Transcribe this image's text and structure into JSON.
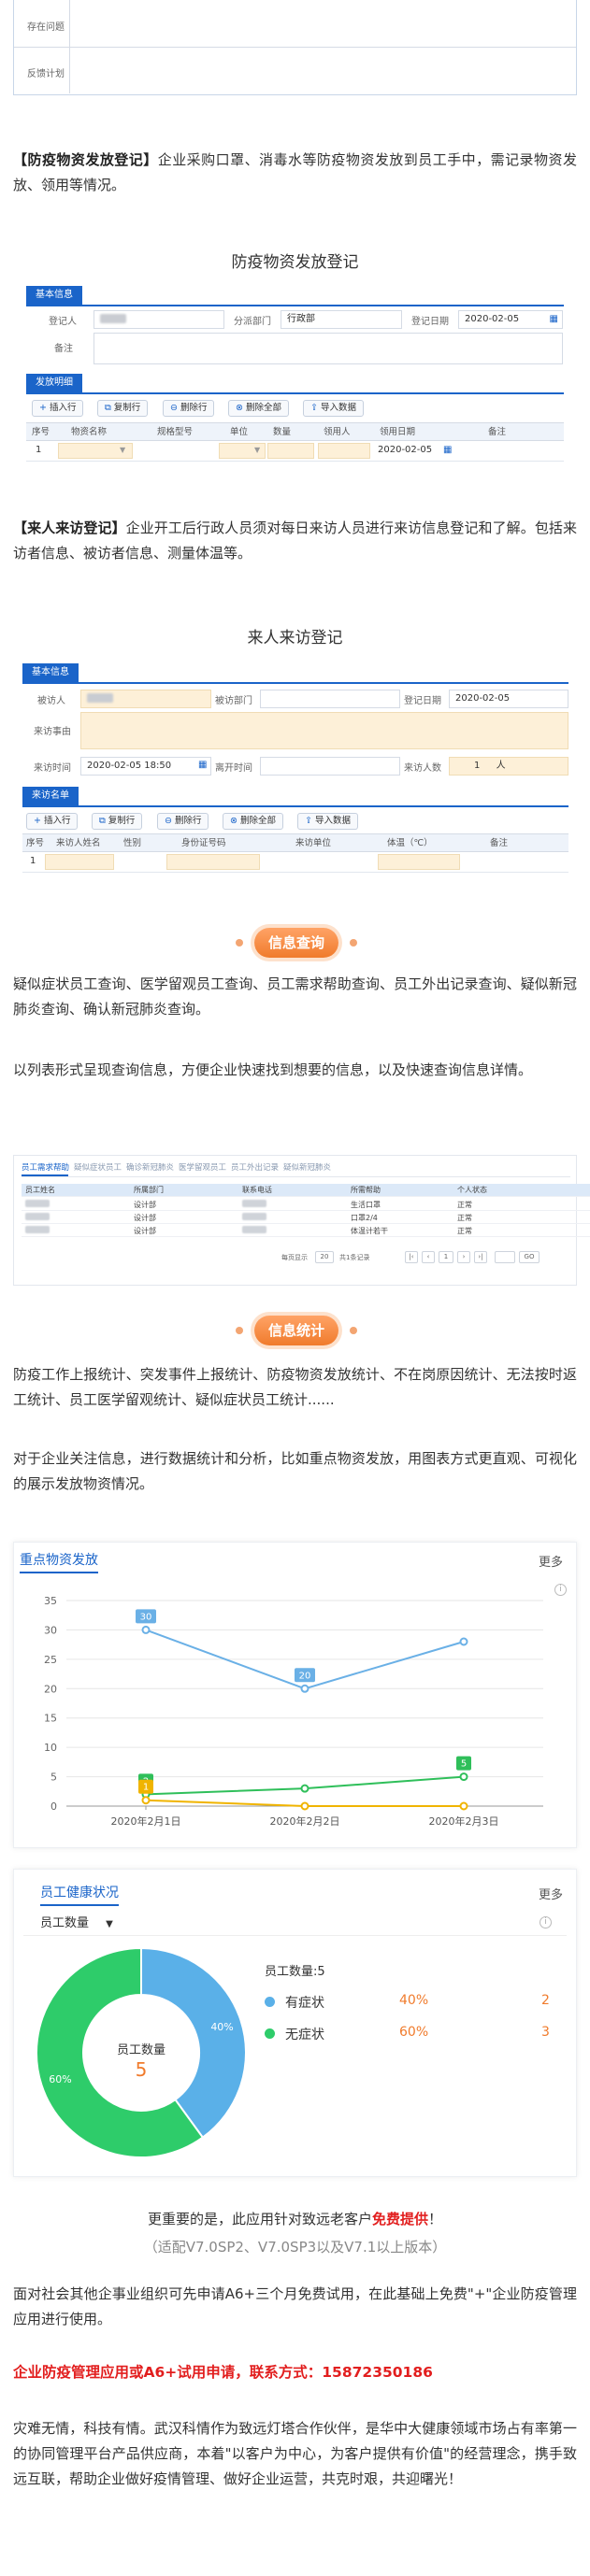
{
  "top_form": {
    "rows": [
      {
        "label": "存在问题"
      },
      {
        "label": "反馈计划"
      }
    ]
  },
  "intro_supplies": {
    "heading": "【防疫物资发放登记】",
    "text": "企业采购口罩、消毒水等防疫物资发放到员工手中，需记录物资发放、领用等情况。"
  },
  "supply_form": {
    "title": "防疫物资发放登记",
    "basic_tag": "基本信息",
    "registrant_label": "登记人",
    "dept_label": "分派部门",
    "dept_value": "行政部",
    "date_label": "登记日期",
    "date_value": "2020-02-05",
    "remark_label": "备注",
    "detail_tag": "发放明细",
    "buttons": {
      "insert": "插入行",
      "copy": "复制行",
      "delete": "删除行",
      "delete_all": "删除全部",
      "import": "导入数据"
    },
    "columns": [
      "序号",
      "物资名称",
      "规格型号",
      "单位",
      "数量",
      "领用人",
      "领用日期",
      "备注"
    ],
    "row": {
      "index": "1",
      "date": "2020-02-05"
    }
  },
  "intro_visitor": {
    "heading": "【来人来访登记】",
    "text": "企业开工后行政人员须对每日来访人员进行来访信息登记和了解。包括来访者信息、被访者信息、测量体温等。"
  },
  "visitor_form": {
    "title": "来人来访登记",
    "basic_tag": "基本信息",
    "visitee_label": "被访人",
    "visitee_dept_label": "被访部门",
    "reg_date_label": "登记日期",
    "reg_date_value": "2020-02-05",
    "reason_label": "来访事由",
    "visit_time_label": "来访时间",
    "visit_time_value": "2020-02-05 18:50",
    "leave_time_label": "离开时间",
    "count_label": "来访人数",
    "count_value": "1",
    "count_unit": "人",
    "detail_tag": "来访名单",
    "buttons": {
      "insert": "插入行",
      "copy": "复制行",
      "delete": "删除行",
      "delete_all": "删除全部",
      "import": "导入数据"
    },
    "columns": [
      "序号",
      "来访人姓名",
      "性别",
      "身份证号码",
      "来访单位",
      "体温（℃）",
      "备注"
    ],
    "row": {
      "index": "1"
    }
  },
  "query_section": {
    "badge": "信息查询",
    "text1": "疑似症状员工查询、医学留观员工查询、员工需求帮助查询、员工外出记录查询、疑似新冠肺炎查询、确认新冠肺炎查询。",
    "text2": "以列表形式呈现查询信息，方便企业快速找到想要的信息，以及快速查询信息详情。"
  },
  "query_table": {
    "tabs": [
      "员工需求帮助",
      "疑似症状员工",
      "确诊新冠肺炎",
      "医学留观员工",
      "员工外出记录",
      "疑似新冠肺炎"
    ],
    "columns": [
      "员工姓名",
      "所属部门",
      "联系电话",
      "所需帮助",
      "个人状态"
    ],
    "rows": [
      {
        "dept": "设计部",
        "help": "生活口罩",
        "status": "正常"
      },
      {
        "dept": "设计部",
        "help": "口罩2/4",
        "status": "正常"
      },
      {
        "dept": "设计部",
        "help": "体温计若干",
        "status": "正常"
      }
    ],
    "pager": {
      "summary": "每页显示",
      "per_page": "20",
      "total": "共1条记录",
      "page": "1",
      "go": "GO"
    }
  },
  "stats_section": {
    "badge": "信息统计",
    "text1": "防疫工作上报统计、突发事件上报统计、防疫物资发放统计、不在岗原因统计、无法按时返工统计、员工医学留观统计、疑似症状员工统计......",
    "text2": "对于企业关注信息，进行数据统计和分析，比如重点物资发放，用图表方式更直观、可视化的展示发放物资情况。"
  },
  "line_card": {
    "title": "重点物资发放",
    "more": "更多"
  },
  "chart_data": [
    {
      "type": "line",
      "x": [
        "2020年2月1日",
        "2020年2月2日",
        "2020年2月3日"
      ],
      "series": [
        {
          "values": [
            30,
            20,
            28
          ],
          "color": "#6ab0e6",
          "labels": [
            "30",
            "20",
            ""
          ]
        },
        {
          "values": [
            2,
            3,
            5
          ],
          "color": "#2fbf5a",
          "labels": [
            "2",
            "",
            "5"
          ]
        },
        {
          "values": [
            1,
            0,
            0
          ],
          "color": "#f0b400",
          "labels": [
            "1",
            "",
            ""
          ]
        }
      ],
      "yticks": [
        0,
        5,
        10,
        15,
        20,
        25,
        30,
        35
      ],
      "ylim": [
        0,
        35
      ],
      "grid": true
    },
    {
      "type": "pie",
      "title": "员工健康状况",
      "selector": "员工数量",
      "center_label": "员工数量",
      "center_value": "5",
      "legend_title": "员工数量:5",
      "slices": [
        {
          "name": "有症状",
          "percent": "40%",
          "value": 2,
          "color": "#5ab0e8"
        },
        {
          "name": "无症状",
          "percent": "60%",
          "value": 3,
          "color": "#2ecc6a"
        }
      ],
      "more": "更多"
    }
  ],
  "promo": {
    "line1_pre": "更重要的是，此应用针对致远老客户",
    "line1_red": "免费提供",
    "line1_post": "！",
    "line2": "（适配V7.0SP2、V7.0SP3以及V7.1以上版本）",
    "para": "面对社会其他企事业组织可先申请A6+三个月免费试用，在此基础上免费\"+\"企业防疫管理应用进行使用。",
    "contact": "企业防疫管理应用或A6+试用申请，联系方式：15872350186",
    "closing": "灾难无情，科技有情。武汉科情作为致远灯塔合作伙伴，是华中大健康领域市场占有率第一的协同管理平台产品供应商，本着\"以客户为中心，为客户提供有价值\"的经营理念，携手致远互联，帮助企业做好疫情管理、做好企业运营，共克时艰，共迎曙光！"
  }
}
